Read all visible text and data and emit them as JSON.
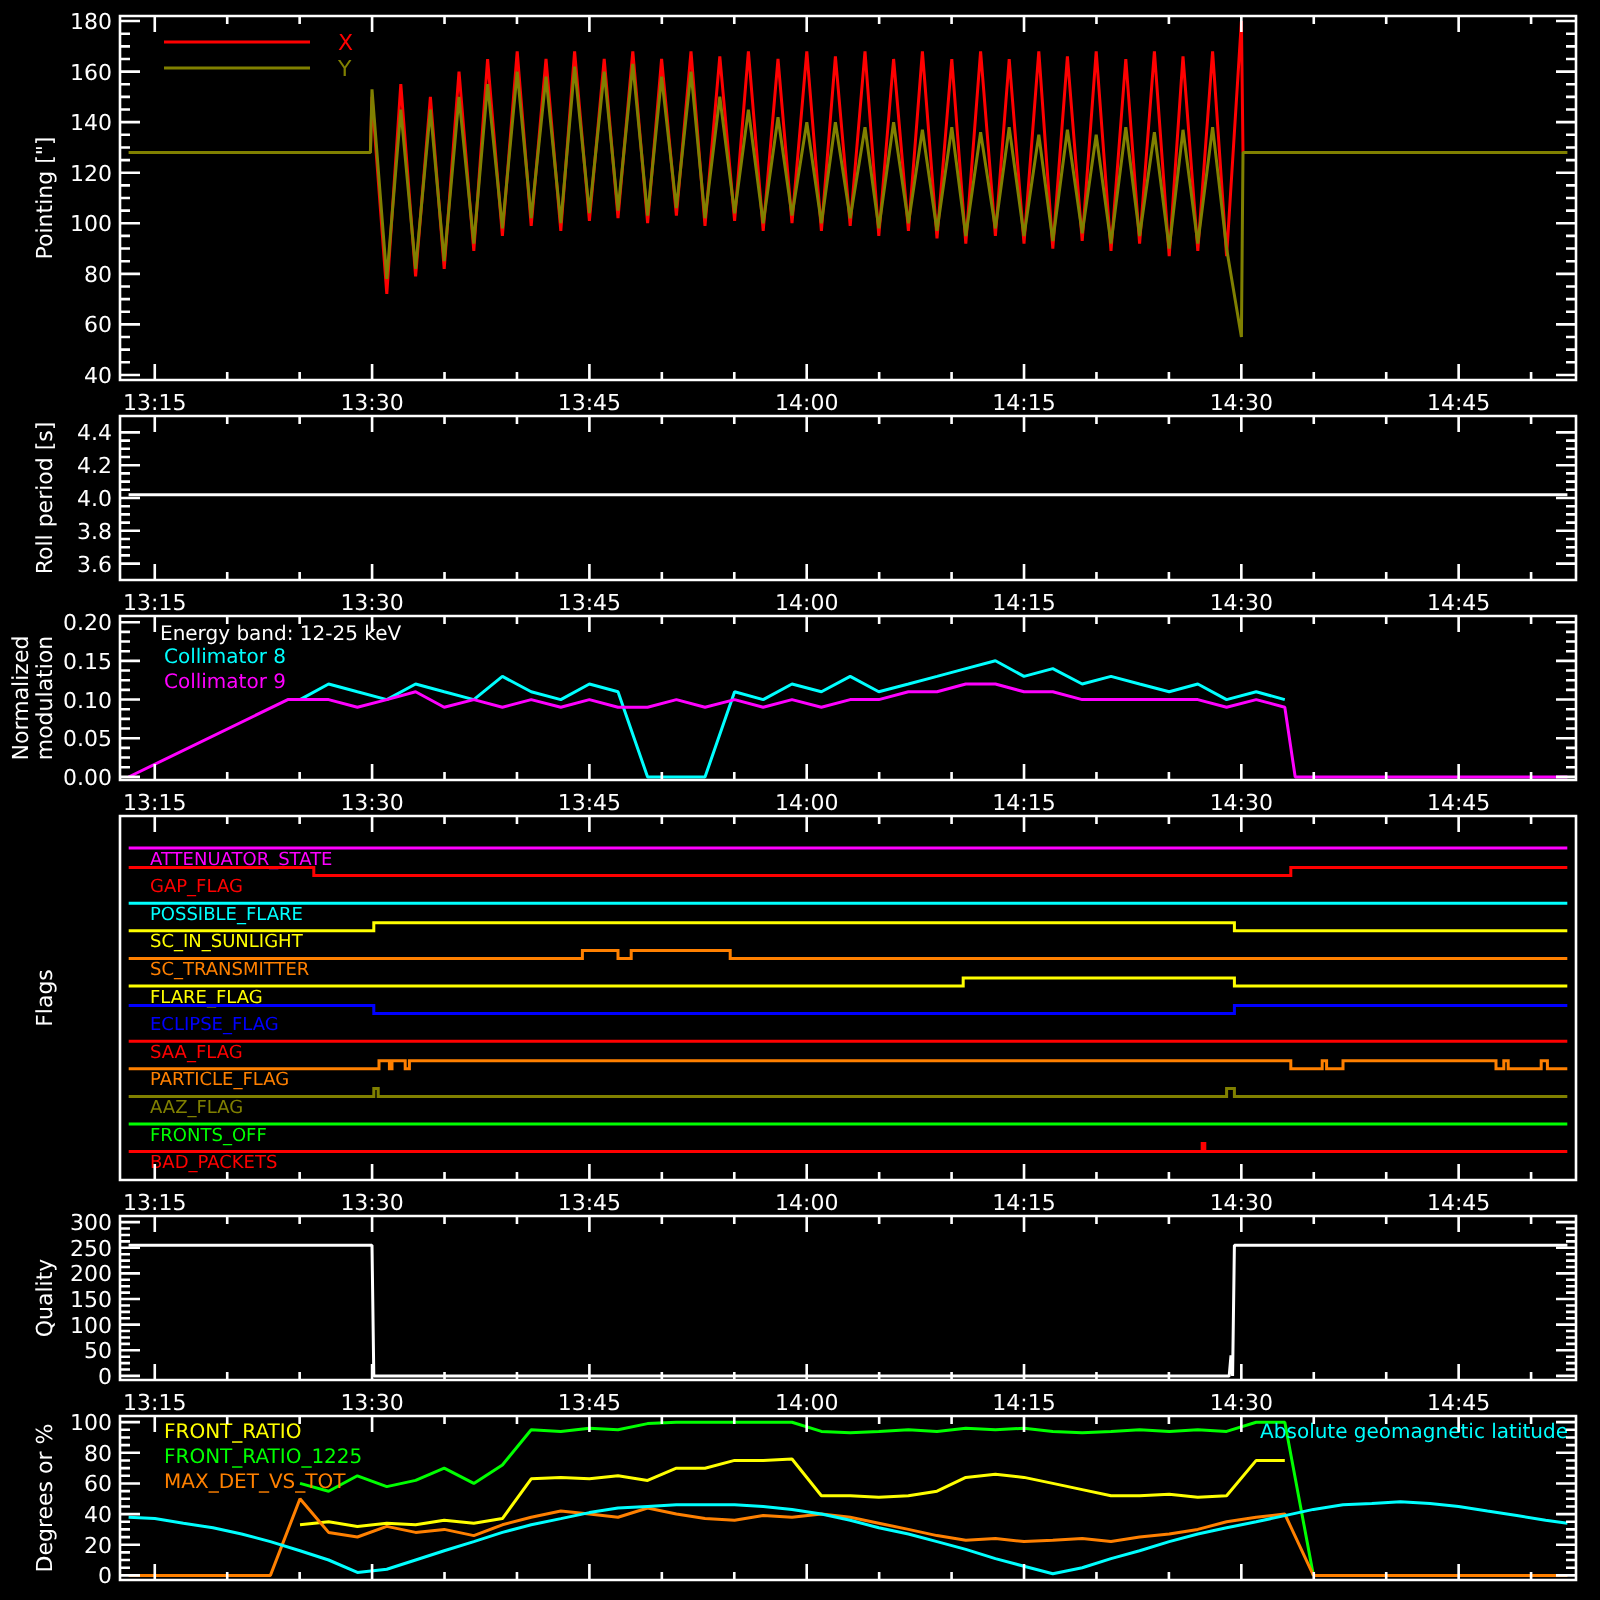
{
  "panels": [
    {
      "kind": "band",
      "chart_data": {
        "type": "line",
        "ylabel": "Pointing [\"]",
        "xlim": [
          13.21,
          14.885
        ],
        "ylim": [
          38,
          182
        ],
        "xticks": [
          {
            "value": 13.25,
            "label": "13:15"
          },
          {
            "value": 13.5,
            "label": "13:30"
          },
          {
            "value": 13.75,
            "label": "13:45"
          },
          {
            "value": 14.0,
            "label": "14:00"
          },
          {
            "value": 14.25,
            "label": "14:15"
          },
          {
            "value": 14.5,
            "label": "14:30"
          },
          {
            "value": 14.75,
            "label": "14:45"
          }
        ],
        "yticks": [
          40,
          60,
          80,
          100,
          120,
          140,
          160,
          180
        ],
        "x": [
          13.22,
          13.498,
          13.5,
          13.517,
          13.533,
          13.55,
          13.567,
          13.583,
          13.6,
          13.617,
          13.633,
          13.65,
          13.667,
          13.683,
          13.7,
          13.717,
          13.733,
          13.75,
          13.767,
          13.783,
          13.8,
          13.817,
          13.833,
          13.85,
          13.867,
          13.883,
          13.9,
          13.917,
          13.933,
          13.95,
          13.967,
          13.983,
          14.0,
          14.017,
          14.033,
          14.05,
          14.067,
          14.083,
          14.1,
          14.117,
          14.133,
          14.15,
          14.167,
          14.183,
          14.2,
          14.217,
          14.233,
          14.25,
          14.267,
          14.283,
          14.3,
          14.317,
          14.333,
          14.35,
          14.367,
          14.383,
          14.4,
          14.417,
          14.433,
          14.45,
          14.467,
          14.483,
          14.5,
          14.502,
          14.875
        ],
        "series": [
          {
            "name": "X",
            "color": "#ff0000",
            "values": [
              null,
              128,
              150,
              72,
              155,
              79,
              150,
              82,
              160,
              89,
              165,
              95,
              168,
              99,
              165,
              97,
              168,
              101,
              165,
              102,
              168,
              100,
              165,
              103,
              168,
              99,
              166,
              101,
              168,
              97,
              165,
              100,
              168,
              97,
              166,
              99,
              168,
              95,
              165,
              97,
              168,
              94,
              165,
              92,
              168,
              95,
              165,
              92,
              168,
              90,
              166,
              93,
              168,
              89,
              165,
              92,
              168,
              87,
              166,
              89,
              168,
              87,
              180,
              128,
              null
            ]
          },
          {
            "name": "Y",
            "color": "#808000",
            "values": [
              128,
              128,
              153,
              78,
              145,
              82,
              145,
              85,
              150,
              92,
              155,
              98,
              160,
              102,
              158,
              100,
              162,
              104,
              160,
              105,
              163,
              103,
              158,
              106,
              160,
              102,
              150,
              104,
              145,
              100,
              142,
              103,
              140,
              100,
              140,
              102,
              138,
              98,
              140,
              100,
              137,
              97,
              138,
              95,
              136,
              98,
              138,
              95,
              135,
              93,
              137,
              96,
              135,
              92,
              138,
              95,
              136,
              90,
              137,
              92,
              138,
              90,
              55,
              128,
              128
            ]
          }
        ]
      }
    },
    {
      "kind": "line",
      "chart_data": {
        "type": "line",
        "ylabel": "Roll period [s]",
        "xlim": [
          13.21,
          14.885
        ],
        "ylim": [
          3.5,
          4.5
        ],
        "xticks": [
          {
            "value": 13.25,
            "label": "13:15"
          },
          {
            "value": 13.5,
            "label": "13:30"
          },
          {
            "value": 13.75,
            "label": "13:45"
          },
          {
            "value": 14.0,
            "label": "14:00"
          },
          {
            "value": 14.25,
            "label": "14:15"
          },
          {
            "value": 14.5,
            "label": "14:30"
          },
          {
            "value": 14.75,
            "label": "14:45"
          }
        ],
        "yticks": [
          {
            "value": 3.6,
            "label": "3.6"
          },
          {
            "value": 3.8,
            "label": "3.8"
          },
          {
            "value": 4.0,
            "label": "4.0"
          },
          {
            "value": 4.2,
            "label": "4.2"
          },
          {
            "value": 4.4,
            "label": "4.4"
          }
        ],
        "x": [
          13.22,
          14.875
        ],
        "series": [
          {
            "color": "#ffffff",
            "values": [
              4.02,
              4.02
            ]
          }
        ]
      }
    },
    {
      "kind": "line",
      "chart_data": {
        "type": "line",
        "title": "Energy band: 12-25 keV",
        "ylabel": "Normalized modulation",
        "xlim": [
          13.21,
          14.885
        ],
        "ylim": [
          -0.004,
          0.208
        ],
        "xticks": [
          {
            "value": 13.25,
            "label": "13:15"
          },
          {
            "value": 13.5,
            "label": "13:30"
          },
          {
            "value": 13.75,
            "label": "13:45"
          },
          {
            "value": 14.0,
            "label": "14:00"
          },
          {
            "value": 14.25,
            "label": "14:15"
          },
          {
            "value": 14.5,
            "label": "14:30"
          },
          {
            "value": 14.75,
            "label": "14:45"
          }
        ],
        "yticks": [
          {
            "value": 0,
            "label": "0.00"
          },
          {
            "value": 0.05,
            "label": "0.05"
          },
          {
            "value": 0.1,
            "label": "0.10"
          },
          {
            "value": 0.15,
            "label": "0.15"
          },
          {
            "value": 0.2,
            "label": "0.20"
          }
        ],
        "x": [
          13.22,
          13.403,
          13.417,
          13.45,
          13.483,
          13.517,
          13.55,
          13.583,
          13.617,
          13.65,
          13.683,
          13.717,
          13.75,
          13.783,
          13.817,
          13.85,
          13.883,
          13.917,
          13.95,
          13.983,
          14.017,
          14.05,
          14.083,
          14.117,
          14.15,
          14.183,
          14.217,
          14.25,
          14.283,
          14.317,
          14.35,
          14.383,
          14.417,
          14.45,
          14.483,
          14.517,
          14.55,
          14.562,
          14.875
        ],
        "series": [
          {
            "name": "Collimator 8",
            "color": "#00ffff",
            "values": [
              null,
              null,
              0.1,
              0.12,
              0.11,
              0.1,
              0.12,
              0.11,
              0.1,
              0.13,
              0.11,
              0.1,
              0.12,
              0.11,
              0,
              0,
              0,
              0.11,
              0.1,
              0.12,
              0.11,
              0.13,
              0.11,
              0.12,
              0.13,
              0.14,
              0.15,
              0.13,
              0.14,
              0.12,
              0.13,
              0.12,
              0.11,
              0.12,
              0.1,
              0.11,
              0.1,
              null,
              null
            ]
          },
          {
            "name": "Collimator 9",
            "color": "#ff00ff",
            "values": [
              0,
              0.1,
              0.1,
              0.1,
              0.09,
              0.1,
              0.11,
              0.09,
              0.1,
              0.09,
              0.1,
              0.09,
              0.1,
              0.09,
              0.09,
              0.1,
              0.09,
              0.1,
              0.09,
              0.1,
              0.09,
              0.1,
              0.1,
              0.11,
              0.11,
              0.12,
              0.12,
              0.11,
              0.11,
              0.1,
              0.1,
              0.1,
              0.1,
              0.1,
              0.09,
              0.1,
              0.09,
              0,
              0
            ]
          }
        ]
      }
    },
    {
      "kind": "flags",
      "title": "Flags",
      "axis_labels": [
        "13:15",
        "13:30",
        "13:45",
        "14:00",
        "14:15",
        "14:30",
        "14:45"
      ],
      "rows": [
        {
          "label": "ATTENUATOR_STATE",
          "color": "#ff00ff"
        },
        {
          "label": "GAP_FLAG",
          "color": "#ff0000"
        },
        {
          "label": "POSSIBLE_FLARE",
          "color": "#00ffff"
        },
        {
          "label": "SC_IN_SUNLIGHT",
          "color": "#ffff00"
        },
        {
          "label": "SC_TRANSMITTER",
          "color": "#ff8000"
        },
        {
          "label": "FLARE_FLAG",
          "color": "#ffff00"
        },
        {
          "label": "ECLIPSE_FLAG",
          "color": "#0000ff"
        },
        {
          "label": "SAA_FLAG",
          "color": "#ff0000"
        },
        {
          "label": "PARTICLE_FLAG",
          "color": "#ff8000"
        },
        {
          "label": "AAZ_FLAG",
          "color": "#808000"
        },
        {
          "label": "FRONTS_OFF",
          "color": "#00ff00"
        },
        {
          "label": "BAD_PACKETS",
          "color": "#ff0000"
        }
      ]
    },
    {
      "kind": "line",
      "chart_data": {
        "type": "line",
        "ylabel": "Quality",
        "xlim": [
          13.21,
          14.885
        ],
        "ylim": [
          -8,
          312
        ],
        "xticks": [
          {
            "value": 13.25,
            "label": "13:15"
          },
          {
            "value": 13.5,
            "label": "13:30"
          },
          {
            "value": 13.75,
            "label": "13:45"
          },
          {
            "value": 14.0,
            "label": "14:00"
          },
          {
            "value": 14.25,
            "label": "14:15"
          },
          {
            "value": 14.5,
            "label": "14:30"
          },
          {
            "value": 14.75,
            "label": "14:45"
          }
        ],
        "yticks": [
          0,
          50,
          100,
          150,
          200,
          250,
          300
        ],
        "x": [
          13.22,
          13.5,
          13.502,
          14.486,
          14.488,
          14.49,
          14.492,
          14.875
        ],
        "series": [
          {
            "color": "#ffffff",
            "values": [
              255,
              255,
              0,
              0,
              40,
              0,
              255,
              255
            ]
          }
        ]
      }
    },
    {
      "kind": "line",
      "chart_data": {
        "type": "line",
        "ylabel": "Degrees or %",
        "xlim": [
          13.21,
          14.885
        ],
        "ylim": [
          -3,
          104
        ],
        "yticks": [
          0,
          20,
          40,
          60,
          80,
          100
        ],
        "x": [
          13.22,
          13.25,
          13.283,
          13.317,
          13.35,
          13.383,
          13.417,
          13.45,
          13.483,
          13.517,
          13.55,
          13.583,
          13.617,
          13.65,
          13.683,
          13.717,
          13.75,
          13.783,
          13.817,
          13.85,
          13.883,
          13.917,
          13.95,
          13.983,
          14.017,
          14.05,
          14.083,
          14.117,
          14.15,
          14.183,
          14.217,
          14.25,
          14.283,
          14.317,
          14.35,
          14.383,
          14.417,
          14.45,
          14.483,
          14.517,
          14.55,
          14.583,
          14.617,
          14.65,
          14.683,
          14.717,
          14.75,
          14.783,
          14.817,
          14.85,
          14.875
        ],
        "series": [
          {
            "name": "FRONT_RATIO",
            "color": "#ffff00",
            "values": [
              null,
              null,
              null,
              null,
              null,
              null,
              33,
              35,
              32,
              34,
              33,
              36,
              34,
              37,
              63,
              64,
              63,
              65,
              62,
              70,
              70,
              75,
              75,
              76,
              52,
              52,
              51,
              52,
              55,
              64,
              66,
              64,
              60,
              56,
              52,
              52,
              53,
              51,
              52,
              75,
              75,
              null,
              null,
              null,
              null,
              null,
              null,
              null,
              null,
              null,
              null
            ]
          },
          {
            "name": "FRONT_RATIO_1225",
            "color": "#00ff00",
            "values": [
              null,
              null,
              null,
              null,
              null,
              null,
              60,
              55,
              65,
              58,
              62,
              70,
              60,
              72,
              95,
              94,
              96,
              95,
              99,
              100,
              100,
              100,
              100,
              100,
              94,
              93,
              94,
              95,
              94,
              96,
              95,
              96,
              94,
              93,
              94,
              95,
              94,
              95,
              94,
              100,
              100,
              0,
              null,
              null,
              null,
              null,
              null,
              null,
              null,
              null,
              null
            ]
          },
          {
            "name": "MAX_DET_VS_TOT",
            "color": "#ff8000",
            "values": [
              0,
              0,
              0,
              0,
              0,
              0,
              50,
              28,
              25,
              32,
              28,
              30,
              26,
              33,
              38,
              42,
              40,
              38,
              44,
              40,
              37,
              36,
              39,
              38,
              40,
              38,
              34,
              30,
              26,
              23,
              24,
              22,
              23,
              24,
              22,
              25,
              27,
              30,
              35,
              38,
              40,
              0,
              0,
              0,
              0,
              0,
              0,
              0,
              0,
              0,
              0
            ]
          },
          {
            "name": "Absolute geomagnetic latitude",
            "color": "#00ffff",
            "values": [
              38,
              37,
              34,
              31,
              27,
              22,
              16,
              10,
              2,
              4,
              10,
              16,
              22,
              28,
              33,
              37,
              41,
              44,
              45,
              46,
              46,
              46,
              45,
              43,
              40,
              36,
              31,
              27,
              22,
              17,
              11,
              6,
              1,
              5,
              11,
              16,
              22,
              27,
              31,
              35,
              39,
              43,
              46,
              47,
              48,
              47,
              45,
              42,
              39,
              36,
              34
            ]
          }
        ]
      }
    }
  ]
}
